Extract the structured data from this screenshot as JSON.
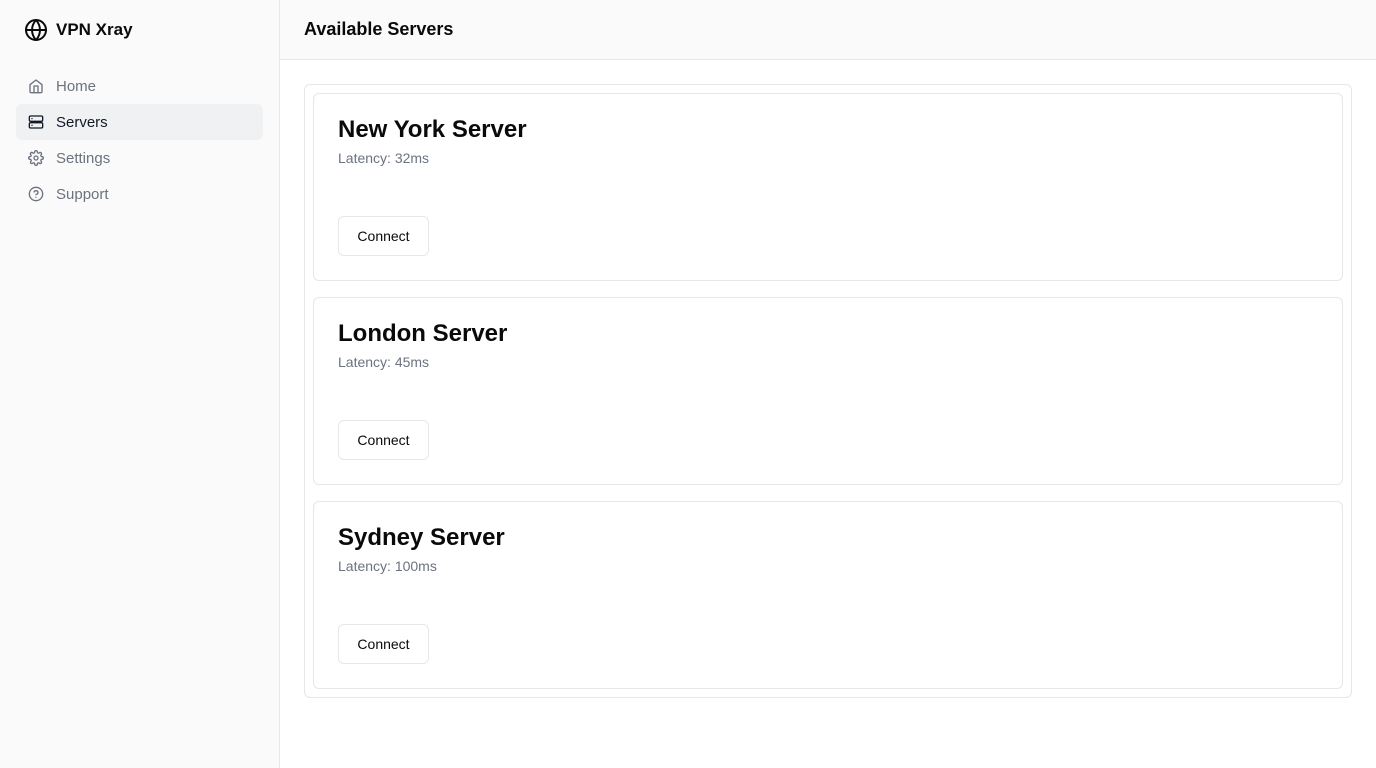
{
  "app": {
    "title": "VPN Xray",
    "logo_icon": "globe-icon"
  },
  "sidebar": {
    "items": [
      {
        "label": "Home",
        "icon": "home-icon",
        "active": false
      },
      {
        "label": "Servers",
        "icon": "server-icon",
        "active": true
      },
      {
        "label": "Settings",
        "icon": "gear-icon",
        "active": false
      },
      {
        "label": "Support",
        "icon": "help-circle-icon",
        "active": false
      }
    ]
  },
  "header": {
    "title": "Available Servers"
  },
  "servers": [
    {
      "name": "New York Server",
      "latency": "Latency: 32ms",
      "action": "Connect"
    },
    {
      "name": "London Server",
      "latency": "Latency: 45ms",
      "action": "Connect"
    },
    {
      "name": "Sydney Server",
      "latency": "Latency: 100ms",
      "action": "Connect"
    }
  ],
  "colors": {
    "muted": "#6b7280",
    "border": "#e5e7eb",
    "active_bg": "#f0f1f3"
  }
}
